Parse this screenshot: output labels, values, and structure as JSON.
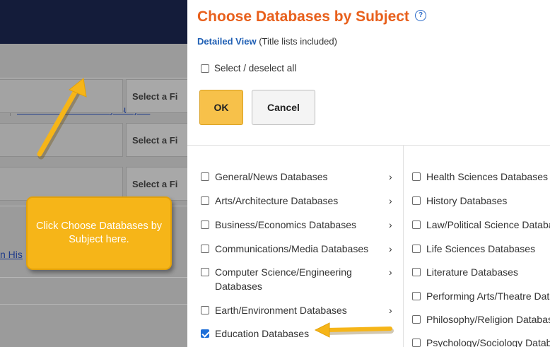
{
  "background": {
    "subject_link": "Choose Databases by Subject",
    "field_placeholder": "Select a Fi",
    "history_link": "n His"
  },
  "callout": {
    "text": "Click Choose Databases by Subject here."
  },
  "panel": {
    "title": "Choose Databases by Subject",
    "help_glyph": "?",
    "detailed_view": "Detailed View",
    "detailed_note": " (Title lists included)",
    "select_all": "Select / deselect all",
    "ok": "OK",
    "cancel": "Cancel",
    "chevron": "›",
    "left_column": [
      {
        "label": "General/News Databases",
        "checked": false
      },
      {
        "label": "Arts/Architecture Databases",
        "checked": false
      },
      {
        "label": "Business/Economics Databases",
        "checked": false
      },
      {
        "label": "Communications/Media Databases",
        "checked": false
      },
      {
        "label": "Computer Science/Engineering",
        "label2": "Databases",
        "checked": false
      },
      {
        "label": "Earth/Environment Databases",
        "checked": false
      },
      {
        "label": "Education Databases",
        "checked": true
      }
    ],
    "right_column": [
      {
        "label": "Health Sciences Databases"
      },
      {
        "label": "History Databases"
      },
      {
        "label": "Law/Political Science Databases"
      },
      {
        "label": "Life Sciences Databases"
      },
      {
        "label": "Literature Databases"
      },
      {
        "label": "Performing Arts/Theatre Databases"
      },
      {
        "label": "Philosophy/Religion Databases"
      },
      {
        "label": "Psychology/Sociology Databases"
      }
    ]
  },
  "colors": {
    "title": "#e8601c",
    "accent_link": "#1f5fb4",
    "callout": "#f6b518",
    "ok_button": "#f7c14a"
  }
}
